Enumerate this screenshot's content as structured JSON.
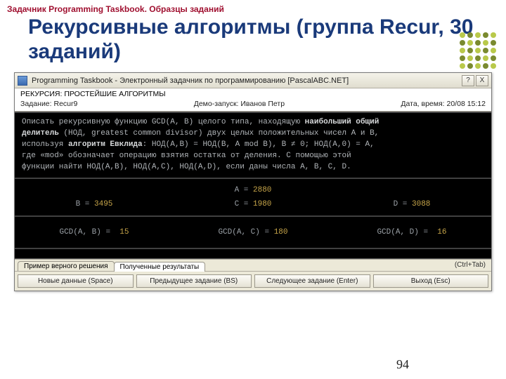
{
  "slide": {
    "header": "Задачник Programming Taskbook. Образцы заданий",
    "title": "Рекурсивные алгоритмы (группа Recur, 30 заданий)",
    "page_number": "94"
  },
  "window": {
    "title": "Programming Taskbook - Электронный задачник по программированию [PascalABC.NET]",
    "help_btn": "?",
    "close_btn": "X"
  },
  "info": {
    "topic": "РЕКУРСИЯ: ПРОСТЕЙШИЕ АЛГОРИТМЫ",
    "task_label": "Задание: Recur9",
    "demo_label": "Демо-запуск: Иванов Петр",
    "datetime_label": "Дата, время: 20/08 15:12"
  },
  "terminal": {
    "desc_1a": "Описать рекурсивную функцию GCD(A, B) целого типа, находящую ",
    "desc_1b": "наибольший общий",
    "desc_2a": "делитель",
    "desc_2b": " (НОД, greatest common divisor) двух целых положительных чисел A и B,",
    "desc_3a": "используя ",
    "desc_3b": "алгоритм Евклида",
    "desc_3c": ": НОД(A,B) = НОД(B, A mod B), B ≠ 0; НОД(A,0) = A,",
    "desc_4": "где «mod» обозначает операцию взятия остатка от деления. С помощью этой",
    "desc_5": "функции найти НОД(A,B), НОД(A,C), НОД(A,D), если даны числа A, B, C, D.",
    "a_lbl": "A =",
    "a_val": "2880",
    "b_lbl": "B =",
    "b_val": "3495",
    "c_lbl": "C =",
    "c_val": "1980",
    "d_lbl": "D =",
    "d_val": "3088",
    "gab_lbl": "GCD(A, B) =",
    "gab_val": "15",
    "gac_lbl": "GCD(A, C) =",
    "gac_val": "180",
    "gad_lbl": "GCD(A, D) =",
    "gad_val": "16"
  },
  "tabs": {
    "tab1": "Пример верного решения",
    "tab2": "Полученные результаты",
    "hint": "(Ctrl+Tab)"
  },
  "buttons": {
    "b1": "Новые данные (Space)",
    "b2": "Предыдущее задание (BS)",
    "b3": "Следующее задание (Enter)",
    "b4": "Выход (Esc)"
  }
}
